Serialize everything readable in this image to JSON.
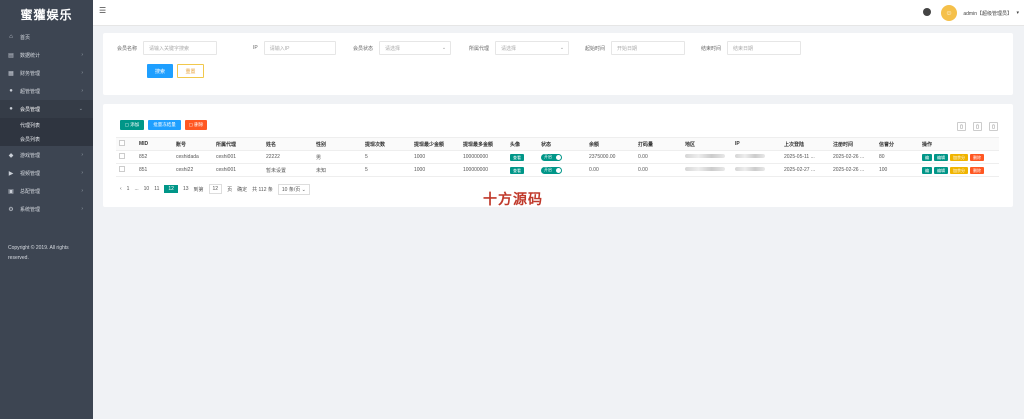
{
  "sidebar": {
    "brand": "蜜獾娱乐",
    "items": [
      {
        "label": "首页",
        "icon": "home-icon",
        "glyph": "⌂",
        "chevron": ""
      },
      {
        "label": "数据统计",
        "icon": "chart-icon",
        "glyph": "▤",
        "chevron": "›"
      },
      {
        "label": "财务管理",
        "icon": "finance-icon",
        "glyph": "▦",
        "chevron": "›"
      },
      {
        "label": "超管管理",
        "icon": "admin-icon",
        "glyph": "●",
        "chevron": "›"
      },
      {
        "label": "会员管理",
        "icon": "members-icon",
        "glyph": "●",
        "chevron": "⌄"
      }
    ],
    "sub_items": [
      "代理列表",
      "会员列表"
    ],
    "items_after": [
      {
        "label": "游戏管理",
        "icon": "game-icon",
        "glyph": "◆",
        "chevron": "›"
      },
      {
        "label": "视频管理",
        "icon": "video-icon",
        "glyph": "▶",
        "chevron": "›"
      },
      {
        "label": "总配管理",
        "icon": "config-icon",
        "glyph": "▣",
        "chevron": "›"
      },
      {
        "label": "系统管理",
        "icon": "settings-icon",
        "glyph": "⚙",
        "chevron": "›"
      }
    ],
    "copyright": "Copyright © 2019. All rights reserved."
  },
  "topbar": {
    "menu_icon": "☰",
    "user_label": "admin【超级管理员】",
    "caret": "▾"
  },
  "search": {
    "fields": [
      {
        "label": "会员名称",
        "placeholder": "请输入关键字搜索",
        "dropdown": false
      },
      {
        "label": "IP",
        "placeholder": "请输入IP",
        "dropdown": false
      },
      {
        "label": "会员状态",
        "placeholder": "请选择",
        "dropdown": true
      },
      {
        "label": "所属代理",
        "placeholder": "请选择",
        "dropdown": true
      },
      {
        "label": "起始时间",
        "placeholder": "开始日期",
        "dropdown": false
      },
      {
        "label": "结束时间",
        "placeholder": "结束日期",
        "dropdown": false
      }
    ],
    "search_label": "搜索",
    "reset_label": "重置"
  },
  "toolbar": {
    "add_label": "添加",
    "batch_label": "批量冻结量",
    "delete_label": "删除",
    "icons": [
      "filter-columns-icon",
      "export-icon",
      "print-icon"
    ]
  },
  "table": {
    "headers": [
      "",
      "MID",
      "账号",
      "所属代理",
      "姓名",
      "性别",
      "提现次数",
      "提现最少金额",
      "提现最多金额",
      "头像",
      "状态",
      "余额",
      "打码量",
      "地区",
      "IP",
      "上次登陆",
      "注册时间",
      "信誉分",
      "操作"
    ],
    "rows": [
      {
        "mid": "852",
        "account": "ceshidada",
        "agent": "ceshi001",
        "name": "22222",
        "gender": "男",
        "withdraw_count": "5",
        "min_amount": "1000",
        "max_amount": "100000000",
        "avatar_label": "查看",
        "status_label": "开启",
        "balance": "2375000.00",
        "wager": "0.00",
        "last_login": "2025-05-11 ...",
        "reg_time": "2025-02-26 ...",
        "credit": "80"
      },
      {
        "mid": "851",
        "account": "ceshi22",
        "agent": "ceshi001",
        "name": "暂未设置",
        "gender": "未知",
        "withdraw_count": "5",
        "min_amount": "1000",
        "max_amount": "100000000",
        "avatar_label": "查看",
        "status_label": "开启",
        "balance": "0.00",
        "wager": "0.00",
        "last_login": "2025-02-27 ...",
        "reg_time": "2025-02-26 ...",
        "credit": "100"
      }
    ],
    "ops": [
      {
        "label": "编",
        "color": "#009688"
      },
      {
        "label": "编辑",
        "color": "#009688"
      },
      {
        "label": "加余分",
        "color": "#f0b400"
      },
      {
        "label": "删除",
        "color": "#ff5722"
      }
    ]
  },
  "pager": {
    "prev": "‹",
    "pages": [
      "1",
      "...",
      "10",
      "11"
    ],
    "current": "12",
    "next_pages": [
      "13"
    ],
    "goto_label": "到第",
    "goto_value": "12",
    "unit": "页",
    "confirm": "确定",
    "total": "共 112 条",
    "per_page": "10 条/页"
  },
  "watermark": "十方源码",
  "colors": {
    "teal": "#009688",
    "blue": "#1e9fff",
    "orange": "#ff5722",
    "yellow": "#f0b400",
    "sidebar": "#3d4552"
  }
}
